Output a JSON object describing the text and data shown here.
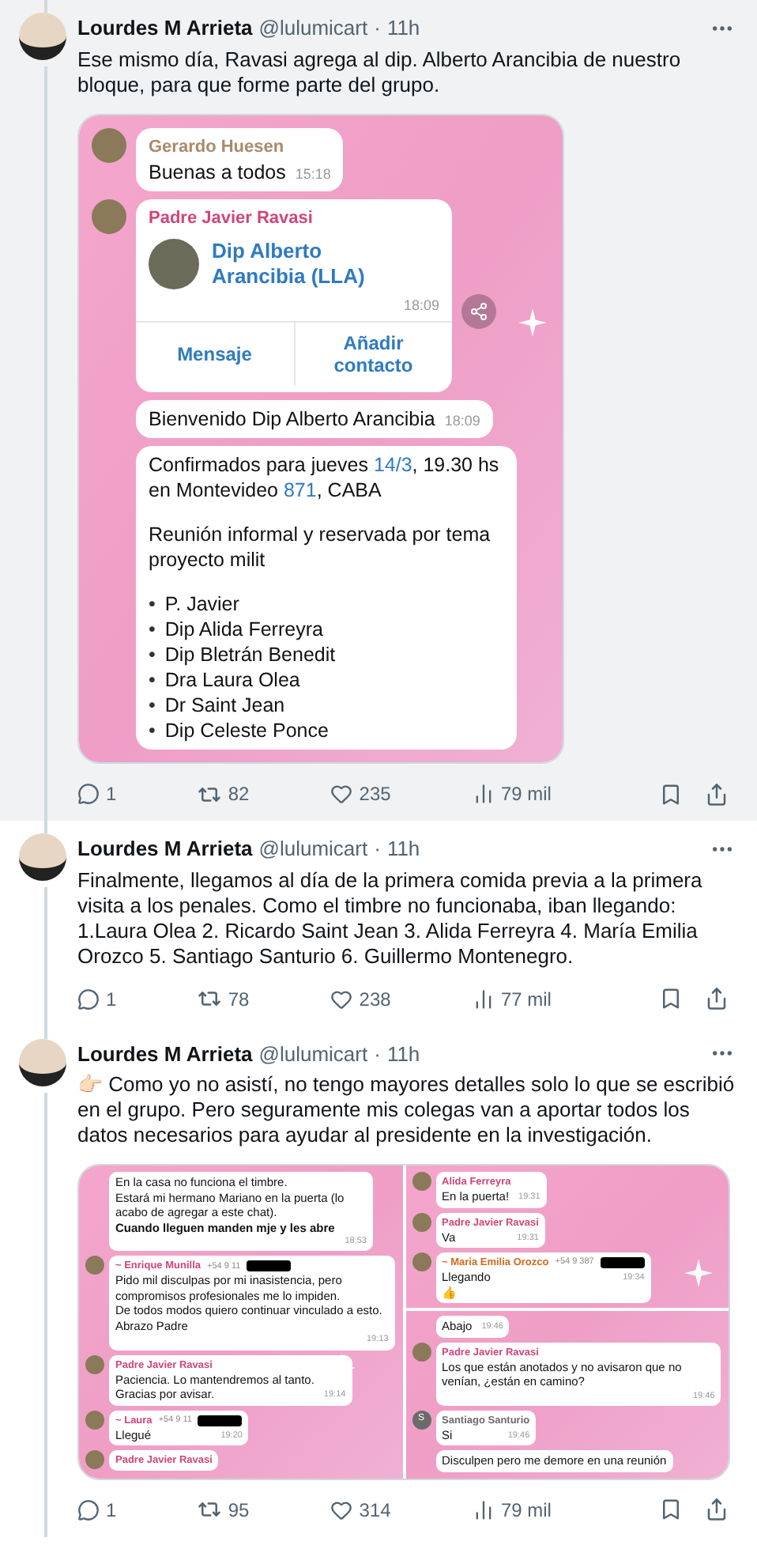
{
  "tweets": [
    {
      "highlighted": true,
      "author": "Lourdes M Arrieta",
      "handle": "@lulumicart",
      "separator": "·",
      "time": "11h",
      "text": "Ese mismo día, Ravasi agrega al dip. Alberto Arancibia de nuestro bloque, para que forme parte del grupo.",
      "media": {
        "kind": "single",
        "panels": [
          {
            "messages": [
              {
                "kind": "text",
                "sender": "Gerardo Huesen",
                "color": "#a98a6a",
                "text": "Buenas a todos",
                "time": "15:18"
              },
              {
                "kind": "contact",
                "sender": "Padre Javier Ravasi",
                "color": "#d0457a",
                "contact": "Dip Alberto Arancibia (LLA)",
                "time": "18:09",
                "buttons": [
                  "Mensaje",
                  "Añadir contacto"
                ]
              },
              {
                "kind": "text",
                "text": "Bienvenido Dip Alberto Arancibia",
                "time": "18:09"
              },
              {
                "kind": "announcement",
                "intro": [
                  {
                    "t": "Confirmados para jueves "
                  },
                  {
                    "t": "14/3",
                    "link": true
                  },
                  {
                    "t": ", 19.30 hs en Montevideo "
                  },
                  {
                    "t": "871",
                    "link": true
                  },
                  {
                    "t": ", CABA"
                  }
                ],
                "note": "Reunión informal y reservada por tema proyecto milit",
                "list": [
                  "P. Javier",
                  "Dip Alida Ferreyra",
                  "Dip Bletrán Benedit",
                  "Dra Laura Olea",
                  "Dr Saint Jean",
                  "Dip Celeste Ponce"
                ],
                "bullet": "•"
              }
            ]
          }
        ]
      },
      "stats": {
        "replies": "1",
        "reposts": "82",
        "likes": "235",
        "views": "79 mil"
      }
    },
    {
      "highlighted": false,
      "author": "Lourdes M Arrieta",
      "handle": "@lulumicart",
      "separator": "·",
      "time": "11h",
      "text": "Finalmente, llegamos al día de la primera comida previa a la primera visita a los penales. Como el timbre no funcionaba, iban llegando:\n1.Laura Olea 2. Ricardo Saint Jean 3. Alida Ferreyra 4. María Emilia Orozco 5. Santiago Santurio 6. Guillermo Montenegro.",
      "stats": {
        "replies": "1",
        "reposts": "78",
        "likes": "238",
        "views": "77 mil"
      }
    },
    {
      "highlighted": false,
      "author": "Lourdes M Arrieta",
      "handle": "@lulumicart",
      "separator": "·",
      "time": "11h",
      "text": "👉🏻 Como yo no asistí, no tengo mayores detalles solo lo que se escribió en el grupo. Pero seguramente mis colegas van a aportar todos los datos necesarios para ayudar al presidente en la investigación.",
      "media": {
        "kind": "pair",
        "panels": [
          {
            "messages": [
              {
                "kind": "text",
                "text": "En la casa no funciona el timbre.\nEstará mi hermano Mariano en la puerta (lo acabo de agregar a este chat).\n**Cuando lleguen manden mje y les abre**",
                "time": "18:53"
              },
              {
                "kind": "text",
                "sender": "~ Enrique Munilla",
                "color": "#d0457a",
                "phone": "+54 9 11",
                "redacted": true,
                "text": "Pido mil disculpas por mi inasistencia, pero compromisos profesionales me lo impiden.\nDe todos modos quiero continuar vinculado a esto.\nAbrazo Padre",
                "time": "19:13"
              },
              {
                "kind": "text",
                "sender": "Padre Javier Ravasi",
                "color": "#d0457a",
                "text": "Paciencia. Lo mantendremos al tanto.\nGracias por avisar.",
                "time": "19:14"
              },
              {
                "kind": "text",
                "sender": "~ Laura",
                "color": "#d0457a",
                "phone": "+54 9 11",
                "redacted": true,
                "text": "Llegué",
                "time": "19:20"
              },
              {
                "kind": "cut",
                "sender": "Padre Javier Ravasi",
                "color": "#d0457a"
              }
            ]
          },
          {
            "messages": [
              {
                "kind": "text",
                "sender": "Alida Ferreyra",
                "color": "#d0457a",
                "text": "En la puerta!",
                "time": "19:31"
              },
              {
                "kind": "text",
                "sender": "Padre Javier Ravasi",
                "color": "#d0457a",
                "text": "Va",
                "time": "19:31"
              },
              {
                "kind": "text",
                "sender": "~ Maria Emilia Orozco",
                "color": "#d2691e",
                "phone": "+54 9 387",
                "redacted": true,
                "text": "Llegando",
                "time": "19:34",
                "reaction": "👍"
              },
              {
                "kind": "divider"
              },
              {
                "kind": "text",
                "text": "Abajo",
                "time": "19:46"
              },
              {
                "kind": "text",
                "sender": "Padre Javier Ravasi",
                "color": "#d0457a",
                "text": "Los que están anotados y no avisaron que no venían, ¿están en camino?",
                "time": "19:46"
              },
              {
                "kind": "text",
                "sender": "Santiago Santurio",
                "color": "#6b6b6b",
                "avatar_letter": "S",
                "text": "Si",
                "time": "19:46"
              },
              {
                "kind": "text",
                "text": "Disculpen pero me demore en una reunión"
              }
            ]
          }
        ]
      },
      "stats": {
        "replies": "1",
        "reposts": "95",
        "likes": "314",
        "views": "79 mil"
      }
    }
  ]
}
